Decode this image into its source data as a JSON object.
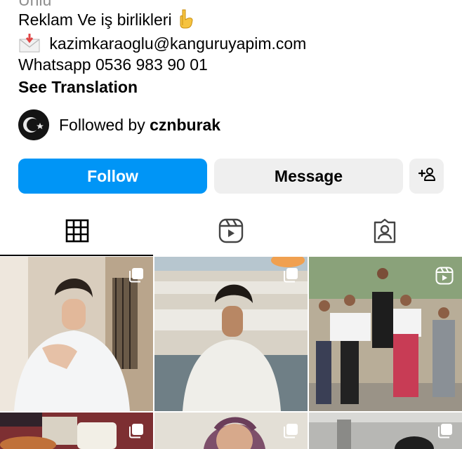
{
  "bio": {
    "cut_line": "Ünlü",
    "line1": "Reklam Ve iş birlikleri",
    "line1_emoji": "point-down-emoji",
    "line2_emoji": "envelope-with-arrow-emoji",
    "line2": "kazimkaraoglu@kanguruyapim.com",
    "line3": "Whatsapp 0536 983 90 01",
    "translation_link": "See Translation"
  },
  "followed_by": {
    "prefix": "Followed by",
    "username": "cznburak"
  },
  "actions": {
    "follow_label": "Follow",
    "message_label": "Message",
    "add_user_icon": "add-person-icon"
  },
  "tabs": [
    {
      "icon": "grid-icon",
      "active": true
    },
    {
      "icon": "reels-icon",
      "active": false
    },
    {
      "icon": "tagged-icon",
      "active": false
    }
  ],
  "colors": {
    "accent": "#0095f6",
    "secondary_button": "#efefef"
  },
  "grid_posts": [
    {
      "type": "carousel",
      "description_icon": "carousel-icon"
    },
    {
      "type": "carousel",
      "description_icon": "carousel-icon"
    },
    {
      "type": "reel",
      "description_icon": "reels-icon"
    },
    {
      "type": "carousel",
      "description_icon": "carousel-icon"
    },
    {
      "type": "carousel",
      "description_icon": "carousel-icon"
    },
    {
      "type": "carousel",
      "description_icon": "carousel-icon"
    }
  ]
}
